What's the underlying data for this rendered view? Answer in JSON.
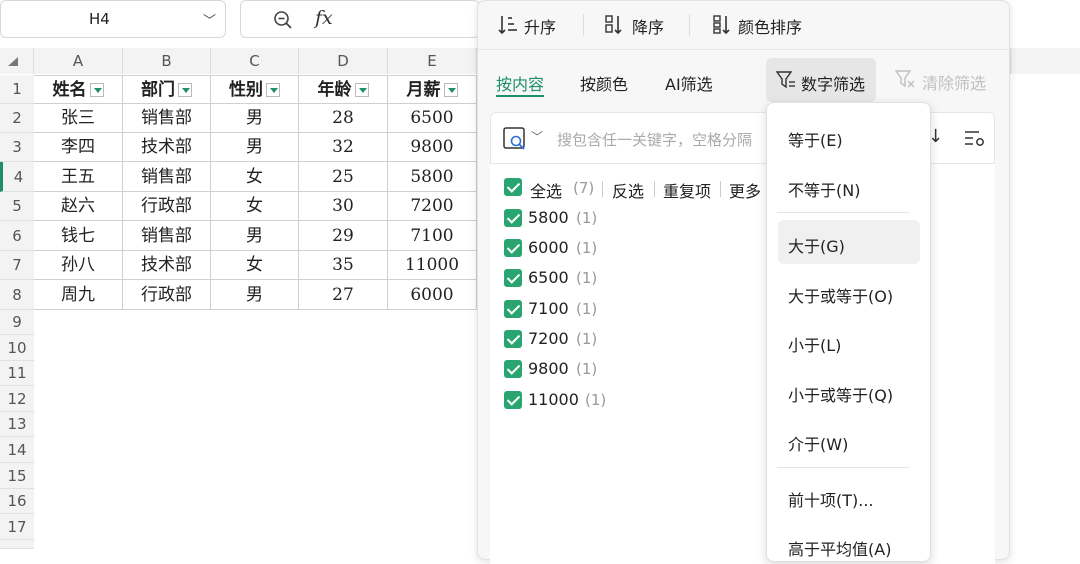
{
  "formula_bar": {
    "cell_ref": "H4",
    "fx_label": "fx"
  },
  "grid": {
    "columns": [
      "A",
      "B",
      "C",
      "D",
      "E"
    ],
    "rows": [
      "1",
      "2",
      "3",
      "4",
      "5",
      "6",
      "7",
      "8",
      "9",
      "10",
      "11",
      "12",
      "13",
      "14",
      "15",
      "16",
      "17"
    ],
    "headers": [
      "姓名",
      "部门",
      "性别",
      "年龄",
      "月薪"
    ],
    "data": [
      [
        "张三",
        "销售部",
        "男",
        "28",
        "6500"
      ],
      [
        "李四",
        "技术部",
        "男",
        "32",
        "9800"
      ],
      [
        "王五",
        "销售部",
        "女",
        "25",
        "5800"
      ],
      [
        "赵六",
        "行政部",
        "女",
        "30",
        "7200"
      ],
      [
        "钱七",
        "销售部",
        "男",
        "29",
        "7100"
      ],
      [
        "孙八",
        "技术部",
        "女",
        "35",
        "11000"
      ],
      [
        "周九",
        "行政部",
        "男",
        "27",
        "6000"
      ]
    ]
  },
  "filter_panel": {
    "sort": {
      "asc": "升序",
      "desc": "降序",
      "by_color": "颜色排序"
    },
    "tabs": {
      "by_content": "按内容",
      "by_color": "按颜色",
      "ai": "AI筛选",
      "number": "数字筛选",
      "clear": "清除筛选"
    },
    "search_placeholder": "搜包含任一关键字，空格分隔",
    "actions": {
      "select_all": "全选",
      "select_all_count": "(7)",
      "invert": "反选",
      "duplicates": "重复项",
      "more": "更多"
    },
    "items": [
      {
        "value": "5800",
        "count": "(1)"
      },
      {
        "value": "6000",
        "count": "(1)"
      },
      {
        "value": "6500",
        "count": "(1)"
      },
      {
        "value": "7100",
        "count": "(1)"
      },
      {
        "value": "7200",
        "count": "(1)"
      },
      {
        "value": "9800",
        "count": "(1)"
      },
      {
        "value": "11000",
        "count": "(1)"
      }
    ]
  },
  "number_filter_menu": {
    "equal": "等于(E)",
    "not_equal": "不等于(N)",
    "greater": "大于(G)",
    "greater_equal": "大于或等于(O)",
    "less": "小于(L)",
    "less_equal": "小于或等于(Q)",
    "between": "介于(W)",
    "top_ten": "前十项(T)...",
    "above_average": "高于平均值(A)"
  },
  "colors": {
    "accent": "#1f8f6a",
    "checkbox": "#2aa571",
    "header_bg": "#f3f3f3"
  }
}
